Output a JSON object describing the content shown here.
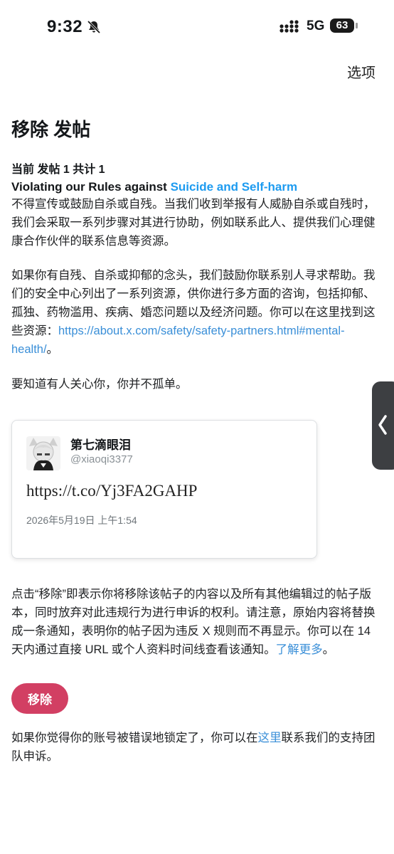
{
  "status_bar": {
    "time": "9:32",
    "network": "5G",
    "battery": "63",
    "icons": [
      "bell-muted-icon",
      "signal-icon",
      "battery-icon"
    ]
  },
  "header": {
    "options_label": "选项",
    "title": "移除 发帖"
  },
  "violation": {
    "count_label": "当前 发帖 1 共计 1",
    "rule_prefix": "Violating our Rules against",
    "rule_link": "Suicide and Self-harm",
    "description": "不得宣传或鼓励自杀或自残。当我们收到举报有人威胁自杀或自残时，我们会采取一系列步骤对其进行协助，例如联系此人、提供我们心理健康合作伙伴的联系信息等资源。",
    "help_text": "如果你有自残、自杀或抑郁的念头，我们鼓励你联系别人寻求帮助。我们的安全中心列出了一系列资源，供你进行多方面的咨询，包括抑郁、孤独、药物滥用、疾病、婚恋问题以及经济问题。你可以在这里找到这些资源：",
    "help_link": "https://about.x.com/safety/safety-partners.html#mental-health/",
    "help_suffix": "。",
    "care_text": "要知道有人关心你，你并不孤单。"
  },
  "post": {
    "display_name": "第七滴眼泪",
    "handle": "@xiaoqi3377",
    "content": "https://t.co/Yj3FA2GAHP",
    "timestamp": "2026年5月19日 上午1:54"
  },
  "notice": {
    "text": "点击“移除”即表示你将移除该帖子的内容以及所有其他编辑过的帖子版本，同时放弃对此违规行为进行申诉的权利。请注意，原始内容将替换成一条通知，表明你的帖子因为违反 X 规则而不再显示。你可以在 14 天内通过直接 URL 或个人资料时间线查看该通知。",
    "learn_more": "了解更多",
    "suffix": "。"
  },
  "actions": {
    "remove_label": "移除"
  },
  "footer": {
    "prefix": "如果你觉得你的账号被错误地锁定了，你可以在",
    "link": "这里",
    "suffix": "联系我们的支持团队申诉。"
  },
  "colors": {
    "link": "#1d9bf0",
    "remove_button": "#d23f63",
    "side_tab": "#3d3f42"
  }
}
